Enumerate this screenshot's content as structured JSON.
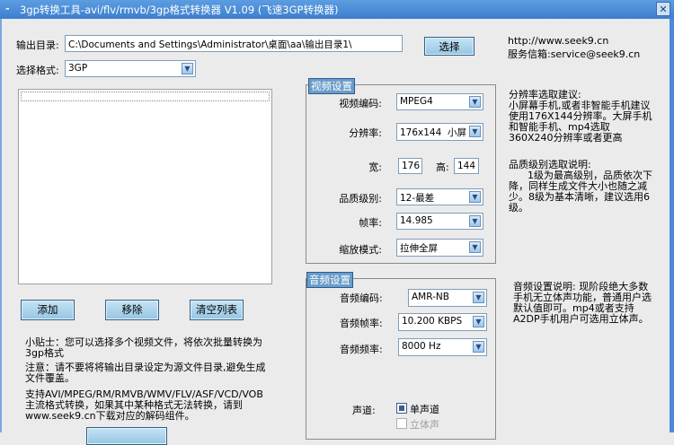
{
  "window": {
    "title": "3gp转换工具-avi/flv/rmvb/3gp格式转换器 V1.09 (飞速3GP转换器)",
    "close_icon": "✕"
  },
  "output": {
    "label": "输出目录:",
    "value": "C:\\Documents and Settings\\Administrator\\桌面\\aa\\输出目录1\\",
    "choose_button": "选择"
  },
  "contact": {
    "url": "http://www.seek9.cn",
    "email": "服务信箱:service@seek9.cn"
  },
  "format": {
    "label": "选择格式:",
    "value": "3GP"
  },
  "file_list": {
    "buttons": {
      "add": "添加",
      "remove": "移除",
      "clear": "清空列表"
    }
  },
  "tips": {
    "tip": "小贴士：您可以选择多个视频文件，将依次批量转换为3gp格式",
    "warning": "注意：请不要将将输出目录设定为源文件目录,避免生成文件覆盖。",
    "support": "支持AVI/MPEG/RM/RMVB/WMV/FLV/ASF/VCD/VOB主流格式转换，如果其中某种格式无法转换，请到www.seek9.cn下载对应的解码组件。"
  },
  "video": {
    "legend": "视频设置",
    "codec": {
      "label": "视频编码:",
      "value": "MPEG4"
    },
    "resolution": {
      "label": "分辨率:",
      "value": "176x144  小屏"
    },
    "width": {
      "label": "宽:",
      "value": "176"
    },
    "height": {
      "label": "高:",
      "value": "144"
    },
    "quality": {
      "label": "品质级别:",
      "value": "12-最差"
    },
    "framerate": {
      "label": "帧率:",
      "value": "14.985"
    },
    "scale": {
      "label": "缩放模式:",
      "value": "拉伸全屏"
    }
  },
  "video_notes": {
    "resolution": "分辨率选取建议:\n小屏幕手机,或者非智能手机建议使用176X144分辨率。大屏手机和智能手机、mp4选取360X240分辨率或者更高",
    "quality": "品质级别选取说明:\n      1级为最高级别，品质依次下降，同样生成文件大小也随之减少。8级为基本清晰，建议选用6级。"
  },
  "audio": {
    "legend": "音频设置",
    "codec": {
      "label": "音频编码:",
      "value": "AMR-NB"
    },
    "bitrate": {
      "label": "音频帧率:",
      "value": "10.200 KBPS"
    },
    "samplerate": {
      "label": "音频频率:",
      "value": "8000 Hz"
    },
    "channel": {
      "label": "声道:",
      "mono": "单声道",
      "stereo": "立体声",
      "mono_checked": true,
      "stereo_enabled": false
    }
  },
  "audio_notes": "音频设置说明:       现阶段绝大多数手机无立体声功能，普通用户选默认值即可。mp4或者支持A2DP手机用户可选用立体声。"
}
